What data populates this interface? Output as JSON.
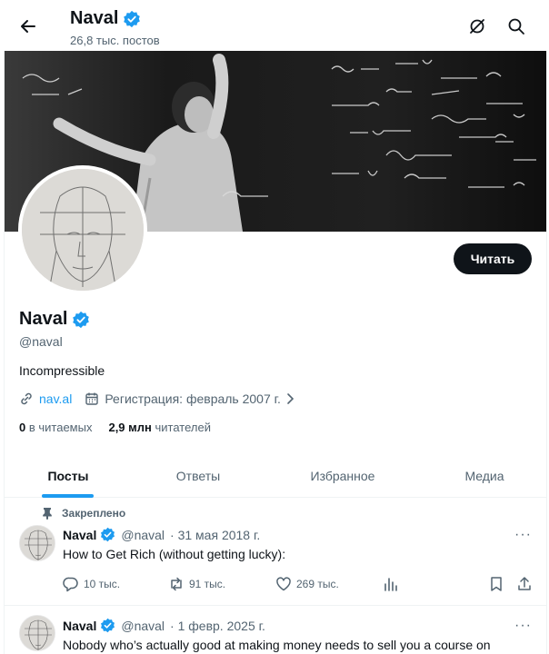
{
  "header": {
    "name": "Naval",
    "posts_count": "26,8 тыс. постов"
  },
  "profile": {
    "name": "Naval",
    "handle": "@naval",
    "bio": "Incompressible",
    "link": "nav.al",
    "joined": "Регистрация: февраль 2007 г.",
    "following_count": "0",
    "following_label": "в читаемых",
    "followers_count": "2,9 млн",
    "followers_label": "читателей",
    "follow_button": "Читать"
  },
  "tabs": [
    {
      "label": "Посты",
      "active": true
    },
    {
      "label": "Ответы",
      "active": false
    },
    {
      "label": "Избранное",
      "active": false
    },
    {
      "label": "Медиа",
      "active": false
    }
  ],
  "pinned_label": "Закреплено",
  "posts": [
    {
      "name": "Naval",
      "handle": "@naval",
      "date": "· 31 мая 2018 г.",
      "text": "How to Get Rich (without getting lucky):",
      "replies": "10 тыс.",
      "reposts": "91 тыс.",
      "likes": "269 тыс."
    },
    {
      "name": "Naval",
      "handle": "@naval",
      "date": "· 1 февр. 2025 г.",
      "text": "Nobody who’s actually good at making money needs to sell you a course on"
    }
  ],
  "colors": {
    "accent": "#1d9bf0",
    "text": "#0f1419",
    "muted": "#536471"
  }
}
